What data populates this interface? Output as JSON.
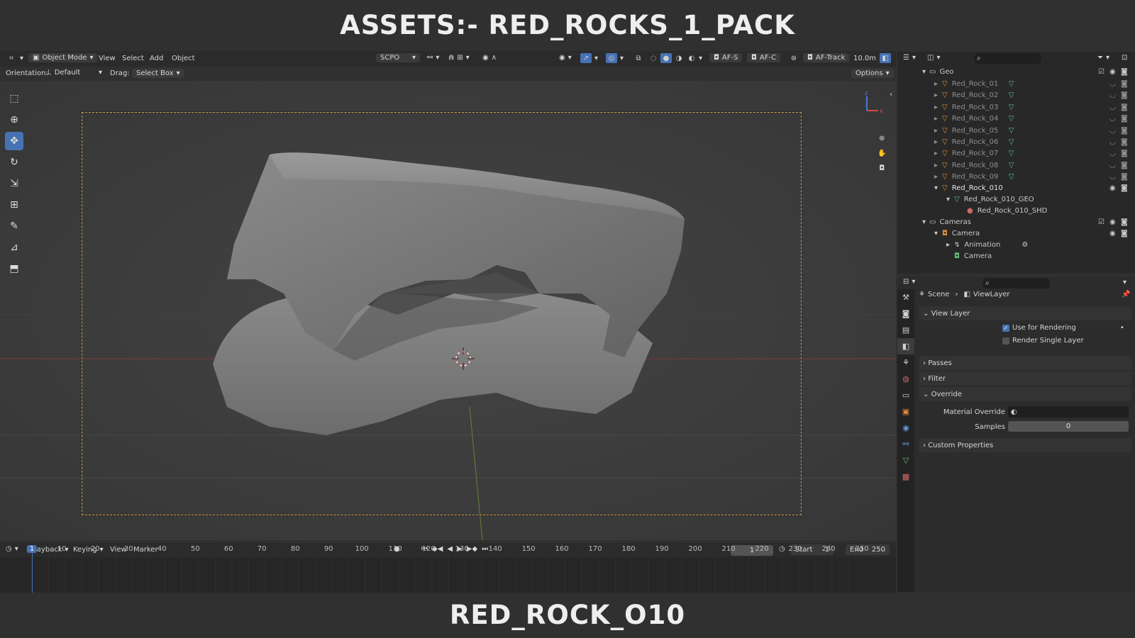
{
  "banners": {
    "top": "ASSETS:- RED_ROCKS_1_PACK",
    "bottom": "RED_ROCK_O10"
  },
  "header": {
    "mode": "Object Mode",
    "menus": [
      "View",
      "Select",
      "Add",
      "Object"
    ],
    "transform_dropdown": "SCPO",
    "af_s": "AF-S",
    "af_c": "AF-C",
    "af_track": "AF-Track",
    "distance": "10.0m",
    "options": "Options",
    "orientation_label": "Orientation:",
    "orientation_value": "Default",
    "drag_label": "Drag:",
    "drag_value": "Select Box"
  },
  "outliner": {
    "geo_collection": "Geo",
    "rocks": [
      "Red_Rock_01",
      "Red_Rock_02",
      "Red_Rock_03",
      "Red_Rock_04",
      "Red_Rock_05",
      "Red_Rock_06",
      "Red_Rock_07",
      "Red_Rock_08",
      "Red_Rock_09"
    ],
    "active_rock": "Red_Rock_010",
    "active_mesh": "Red_Rock_010_GEO",
    "active_material": "Red_Rock_010_SHD",
    "cameras_collection": "Cameras",
    "camera_object": "Camera",
    "animation": "Animation",
    "camera_data": "Camera"
  },
  "properties": {
    "breadcrumb_scene": "Scene",
    "breadcrumb_layer": "ViewLayer",
    "view_layer_header": "View Layer",
    "use_for_rendering": "Use for Rendering",
    "render_single_layer": "Render Single Layer",
    "passes": "Passes",
    "filter": "Filter",
    "override": "Override",
    "material_override_label": "Material Override",
    "samples_label": "Samples",
    "samples_value": "0",
    "custom_properties": "Custom Properties"
  },
  "timeline": {
    "menus": [
      "Playback",
      "Keying",
      "View",
      "Marker"
    ],
    "current_frame": "1",
    "start_label": "Start",
    "start_value": "1",
    "end_label": "End",
    "end_value": "250",
    "ticks": [
      "1",
      "10",
      "20",
      "30",
      "40",
      "50",
      "60",
      "70",
      "80",
      "90",
      "100",
      "110",
      "120",
      "130",
      "140",
      "150",
      "160",
      "170",
      "180",
      "190",
      "200",
      "210",
      "220",
      "230",
      "240",
      "250"
    ]
  },
  "colors": {
    "accent": "#4772b3",
    "camera_frame": "#d9a24a",
    "mesh_orange": "#e08a3a",
    "mesh_green": "#5fbf7a"
  }
}
